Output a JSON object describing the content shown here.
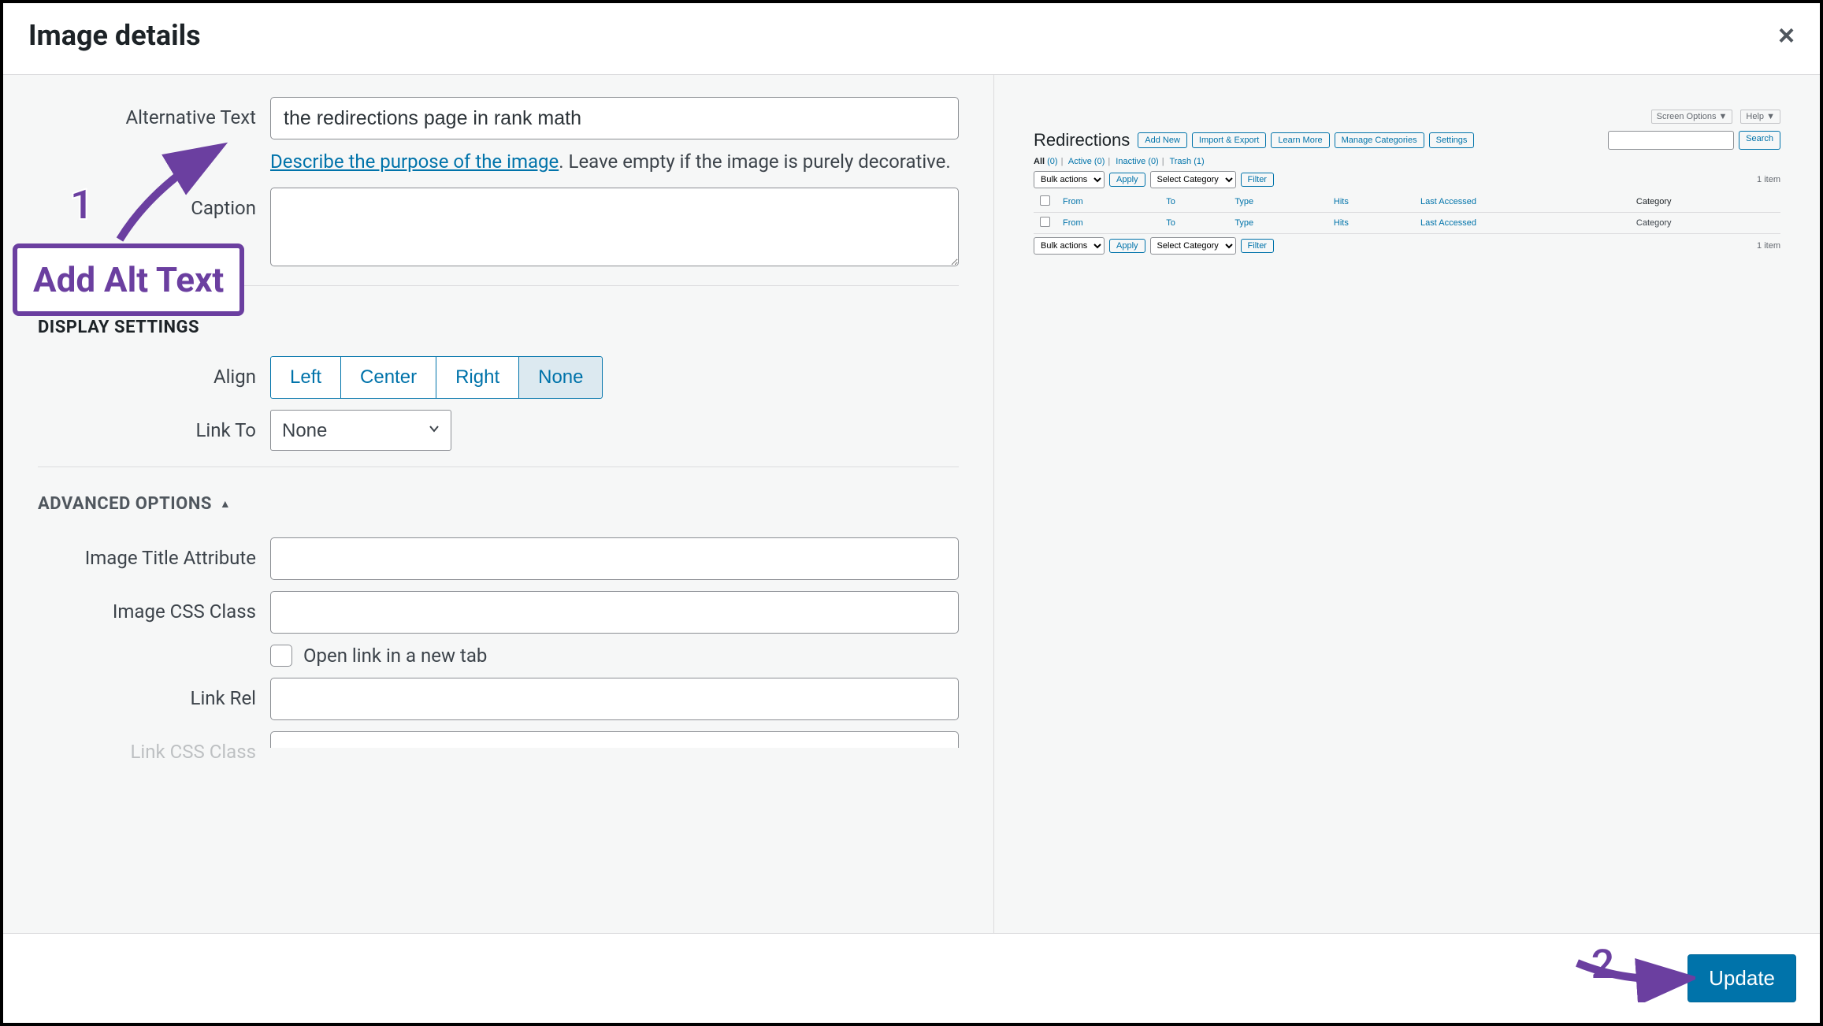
{
  "modal": {
    "title": "Image details",
    "close_label": "×"
  },
  "form": {
    "alt_text_label": "Alternative Text",
    "alt_text_value": "the redirections page in rank math",
    "alt_helper_link": "Describe the purpose of the image",
    "alt_helper_tail": ". Leave empty if the image is purely decorative.",
    "caption_label": "Caption",
    "caption_value": ""
  },
  "display": {
    "heading": "DISPLAY SETTINGS",
    "align_label": "Align",
    "align_options": [
      "Left",
      "Center",
      "Right",
      "None"
    ],
    "align_selected": "None",
    "link_to_label": "Link To",
    "link_to_value": "None"
  },
  "advanced": {
    "heading": "ADVANCED OPTIONS",
    "image_title_label": "Image Title Attribute",
    "image_title_value": "",
    "image_css_label": "Image CSS Class",
    "image_css_value": "",
    "open_new_tab_label": "Open link in a new tab",
    "open_new_tab_checked": false,
    "link_rel_label": "Link Rel",
    "link_rel_value": "",
    "link_css_label": "Link CSS Class"
  },
  "footer": {
    "update_label": "Update"
  },
  "annotations": {
    "callout_1": "Add Alt Text",
    "num_1": "1",
    "num_2": "2"
  },
  "preview": {
    "screen_options": "Screen Options",
    "help": "Help",
    "title": "Redirections",
    "buttons": [
      "Add New",
      "Import & Export",
      "Learn More",
      "Manage Categories",
      "Settings"
    ],
    "search_label": "Search",
    "filter_bar": {
      "all": "All",
      "all_count": "(0)",
      "active": "Active",
      "active_count": "(0)",
      "inactive": "Inactive",
      "inactive_count": "(0)",
      "trash": "Trash",
      "trash_count": "(1)"
    },
    "bulk_actions": "Bulk actions",
    "apply": "Apply",
    "select_cat": "Select Category",
    "filter": "Filter",
    "items_count": "1 item",
    "cols": [
      "From",
      "To",
      "Type",
      "Hits",
      "Last Accessed",
      "Category"
    ]
  }
}
